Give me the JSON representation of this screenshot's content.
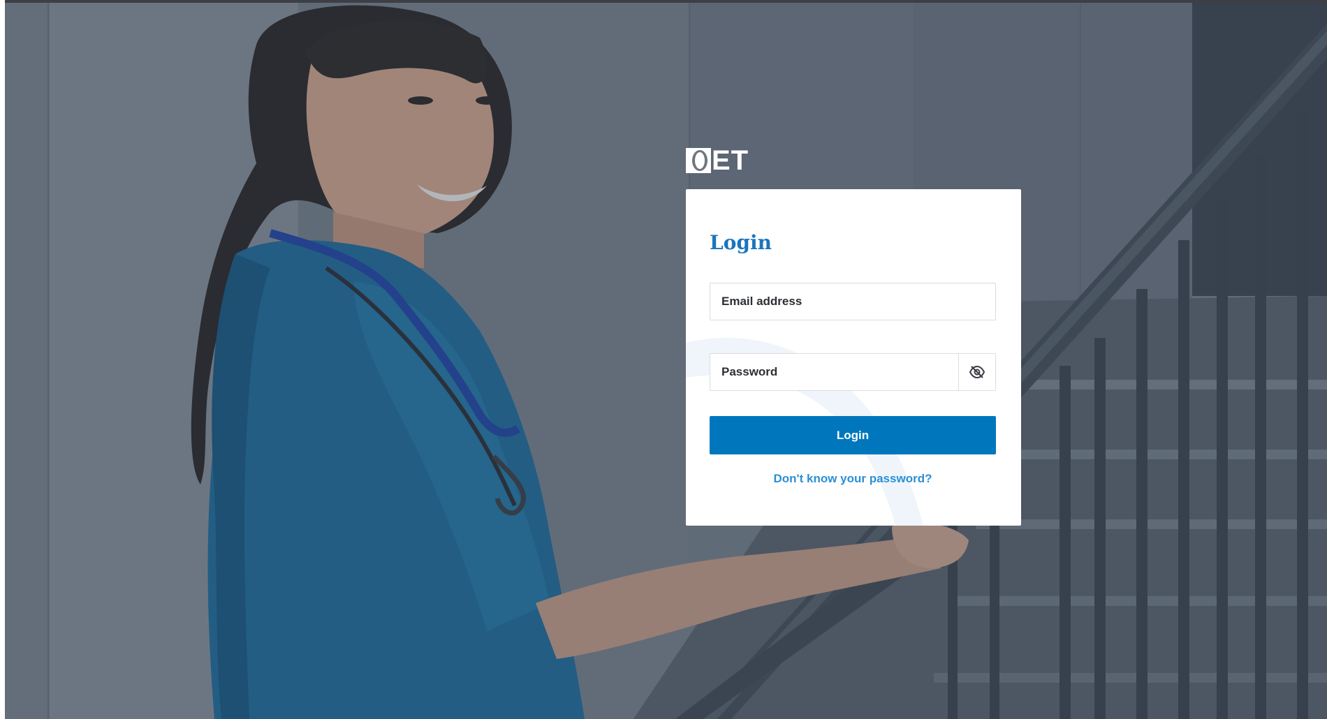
{
  "brand": {
    "logo_text": "ET",
    "logo_letter_o": "O",
    "logo_color": "#ffffff"
  },
  "login_card": {
    "title": "Login",
    "email_placeholder": "Email address",
    "password_placeholder": "Password",
    "toggle_visibility_icon": "eye-slash-icon",
    "submit_label": "Login",
    "forgot_password_label": "Don't know your password?"
  },
  "colors": {
    "accent": "#0077bd",
    "title": "#1b75bc",
    "link": "#2b8fd6",
    "overlay": "#5b6473"
  },
  "background": {
    "image_subject": "nurse in blue scrubs with stethoscope on staircase"
  }
}
